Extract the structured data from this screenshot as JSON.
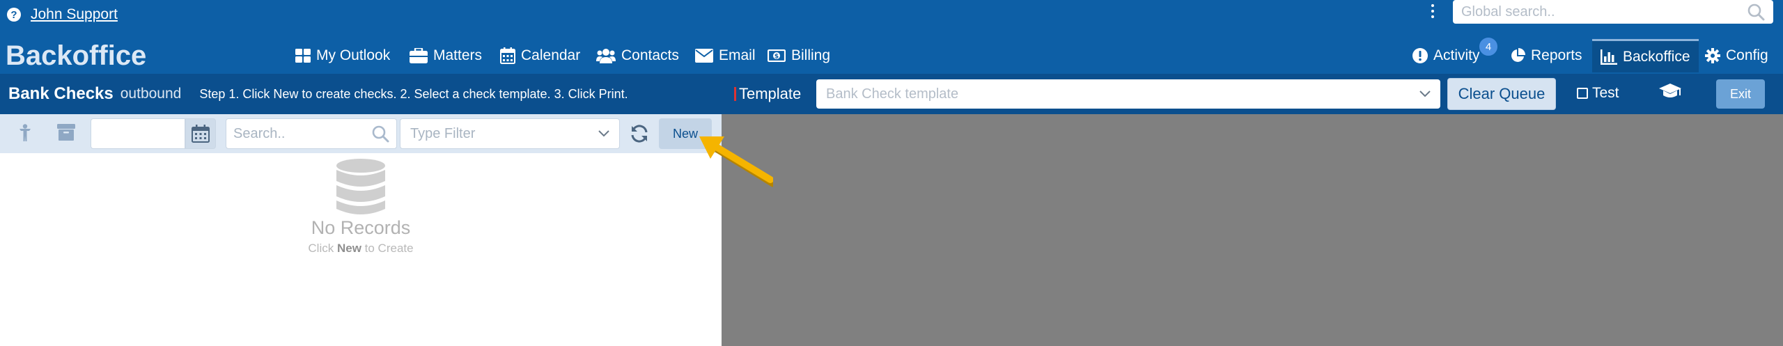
{
  "header": {
    "user_name": "John Support",
    "global_search_placeholder": "Global search..",
    "brand": "Backoffice",
    "nav_left": [
      {
        "label": "My Outlook",
        "icon": "dashboard-icon"
      },
      {
        "label": "Matters",
        "icon": "briefcase-icon"
      },
      {
        "label": "Calendar",
        "icon": "calendar-icon"
      },
      {
        "label": "Contacts",
        "icon": "users-icon"
      },
      {
        "label": "Email",
        "icon": "envelope-icon"
      },
      {
        "label": "Billing",
        "icon": "money-icon"
      }
    ],
    "nav_right": [
      {
        "label": "Activity",
        "icon": "exclamation-icon",
        "badge": "4"
      },
      {
        "label": "Reports",
        "icon": "pie-chart-icon"
      },
      {
        "label": "Backoffice",
        "icon": "bar-chart-icon",
        "active": true
      },
      {
        "label": "Config",
        "icon": "gear-icon"
      }
    ]
  },
  "left_panel": {
    "title": "Bank Checks",
    "subtitle": "outbound",
    "steps": "Step 1. Click New to create checks. 2. Select a check template. 3. Click Print.",
    "search_placeholder": "Search..",
    "type_filter_placeholder": "Type Filter",
    "new_label": "New",
    "empty_title": "No Records",
    "empty_hint_pre": "Click ",
    "empty_hint_bold": "New",
    "empty_hint_post": " to Create"
  },
  "right_panel": {
    "template_label": "Template",
    "template_placeholder": "Bank Check template",
    "clear_queue_label": "Clear Queue",
    "test_label": "Test",
    "exit_label": "Exit"
  },
  "colors": {
    "header_bg": "#0d5fa6",
    "subbar_bg": "#0b4f8e",
    "toolbar_bg": "#dce7f3",
    "viewer_bg": "#808080",
    "arrow": "#f5b400"
  }
}
